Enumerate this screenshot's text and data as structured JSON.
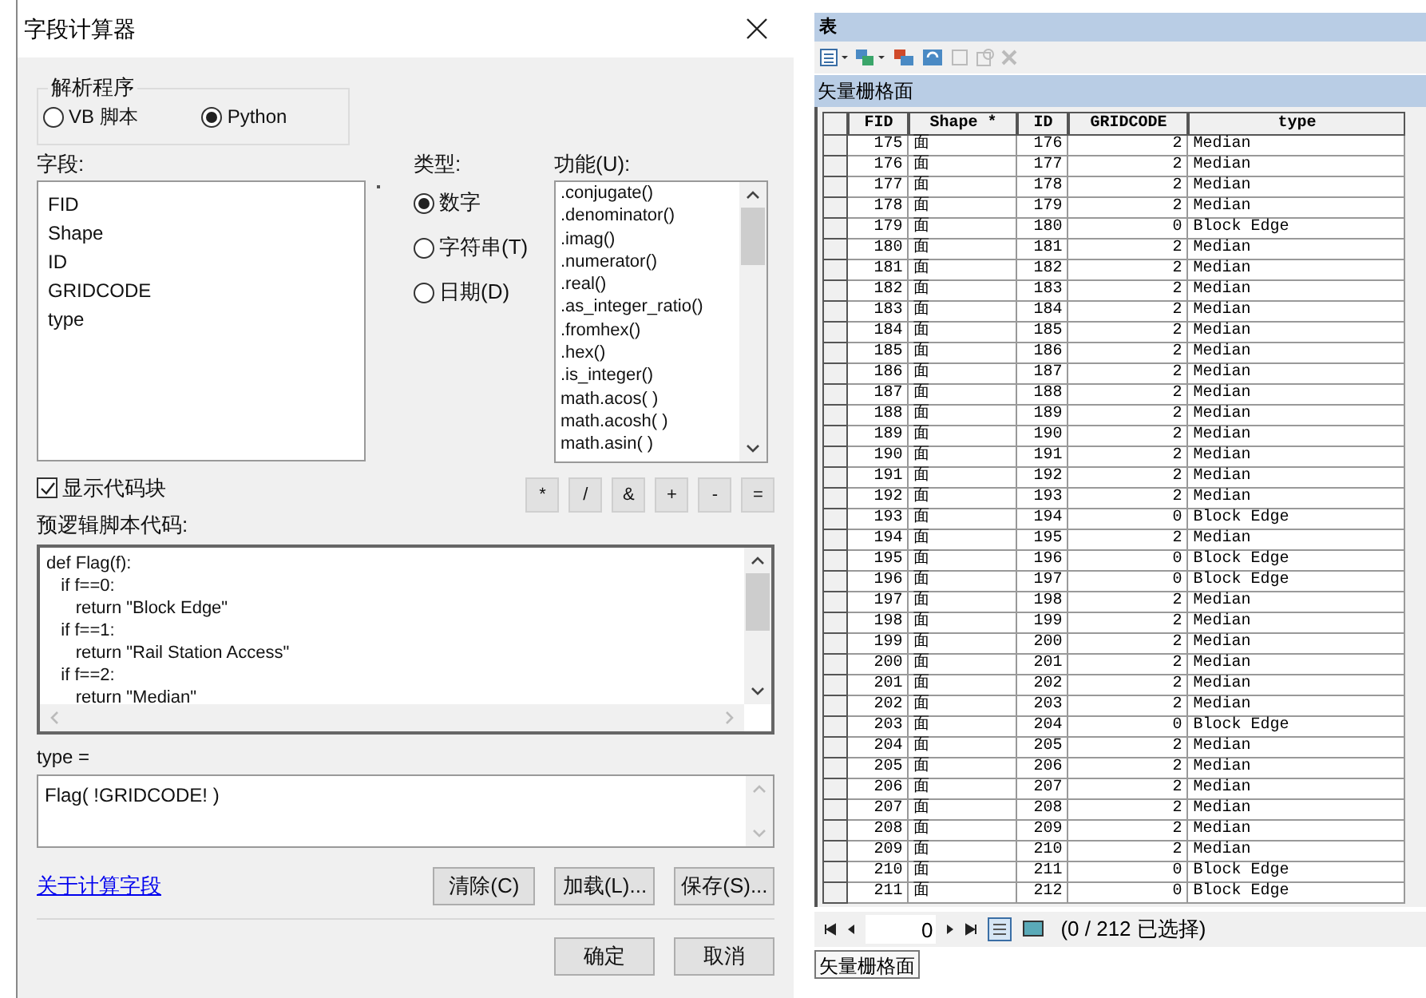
{
  "dialog": {
    "title": "字段计算器",
    "parser": {
      "label": "解析程序",
      "options": [
        {
          "label": "VB 脚本",
          "selected": false
        },
        {
          "label": "Python",
          "selected": true
        }
      ]
    },
    "fields": {
      "label": "字段:",
      "items": [
        "FID",
        "Shape",
        "ID",
        "GRIDCODE",
        "type"
      ]
    },
    "type": {
      "label": "类型:",
      "options": [
        {
          "label": "数字",
          "selected": true
        },
        {
          "label": "字符串(T)",
          "selected": false
        },
        {
          "label": "日期(D)",
          "selected": false
        }
      ]
    },
    "functions": {
      "label": "功能(U):",
      "items": [
        ".conjugate()",
        ".denominator()",
        ".imag()",
        ".numerator()",
        ".real()",
        ".as_integer_ratio()",
        ".fromhex()",
        ".hex()",
        ".is_integer()",
        "math.acos( )",
        "math.acosh( )",
        "math.asin( )"
      ]
    },
    "show_codeblock": {
      "label": "显示代码块",
      "checked": true
    },
    "operators": [
      "*",
      "/",
      "&",
      "+",
      "-",
      "="
    ],
    "codeblock": {
      "label": "预逻辑脚本代码:",
      "lines": [
        "def Flag(f):",
        "   if f==0:",
        "      return \"Block Edge\"",
        "   if f==1:",
        "      return \"Rail Station Access\"",
        "   if f==2:",
        "      return \"Median\""
      ]
    },
    "expression": {
      "label": "type =",
      "value": "Flag( !GRIDCODE! )"
    },
    "help_link": "关于计算字段",
    "file_buttons": [
      "清除(C)",
      "加载(L)...",
      "保存(S)..."
    ],
    "buttons": [
      "确定",
      "取消"
    ]
  },
  "table_window": {
    "title": "表",
    "table_name": "矢量栅格面",
    "columns": [
      "FID",
      "Shape *",
      "ID",
      "GRIDCODE",
      "type"
    ],
    "rows": [
      [
        "175",
        "面",
        "176",
        "2",
        "Median"
      ],
      [
        "176",
        "面",
        "177",
        "2",
        "Median"
      ],
      [
        "177",
        "面",
        "178",
        "2",
        "Median"
      ],
      [
        "178",
        "面",
        "179",
        "2",
        "Median"
      ],
      [
        "179",
        "面",
        "180",
        "0",
        "Block Edge"
      ],
      [
        "180",
        "面",
        "181",
        "2",
        "Median"
      ],
      [
        "181",
        "面",
        "182",
        "2",
        "Median"
      ],
      [
        "182",
        "面",
        "183",
        "2",
        "Median"
      ],
      [
        "183",
        "面",
        "184",
        "2",
        "Median"
      ],
      [
        "184",
        "面",
        "185",
        "2",
        "Median"
      ],
      [
        "185",
        "面",
        "186",
        "2",
        "Median"
      ],
      [
        "186",
        "面",
        "187",
        "2",
        "Median"
      ],
      [
        "187",
        "面",
        "188",
        "2",
        "Median"
      ],
      [
        "188",
        "面",
        "189",
        "2",
        "Median"
      ],
      [
        "189",
        "面",
        "190",
        "2",
        "Median"
      ],
      [
        "190",
        "面",
        "191",
        "2",
        "Median"
      ],
      [
        "191",
        "面",
        "192",
        "2",
        "Median"
      ],
      [
        "192",
        "面",
        "193",
        "2",
        "Median"
      ],
      [
        "193",
        "面",
        "194",
        "0",
        "Block Edge"
      ],
      [
        "194",
        "面",
        "195",
        "2",
        "Median"
      ],
      [
        "195",
        "面",
        "196",
        "0",
        "Block Edge"
      ],
      [
        "196",
        "面",
        "197",
        "0",
        "Block Edge"
      ],
      [
        "197",
        "面",
        "198",
        "2",
        "Median"
      ],
      [
        "198",
        "面",
        "199",
        "2",
        "Median"
      ],
      [
        "199",
        "面",
        "200",
        "2",
        "Median"
      ],
      [
        "200",
        "面",
        "201",
        "2",
        "Median"
      ],
      [
        "201",
        "面",
        "202",
        "2",
        "Median"
      ],
      [
        "202",
        "面",
        "203",
        "2",
        "Median"
      ],
      [
        "203",
        "面",
        "204",
        "0",
        "Block Edge"
      ],
      [
        "204",
        "面",
        "205",
        "2",
        "Median"
      ],
      [
        "205",
        "面",
        "206",
        "2",
        "Median"
      ],
      [
        "206",
        "面",
        "207",
        "2",
        "Median"
      ],
      [
        "207",
        "面",
        "208",
        "2",
        "Median"
      ],
      [
        "208",
        "面",
        "209",
        "2",
        "Median"
      ],
      [
        "209",
        "面",
        "210",
        "2",
        "Median"
      ],
      [
        "210",
        "面",
        "211",
        "0",
        "Block Edge"
      ],
      [
        "211",
        "面",
        "212",
        "0",
        "Block Edge"
      ]
    ],
    "record": "0",
    "selection": "(0 / 212 已选择)",
    "tabs": [
      {
        "label": "矢量栅格面",
        "selected": true
      }
    ]
  }
}
